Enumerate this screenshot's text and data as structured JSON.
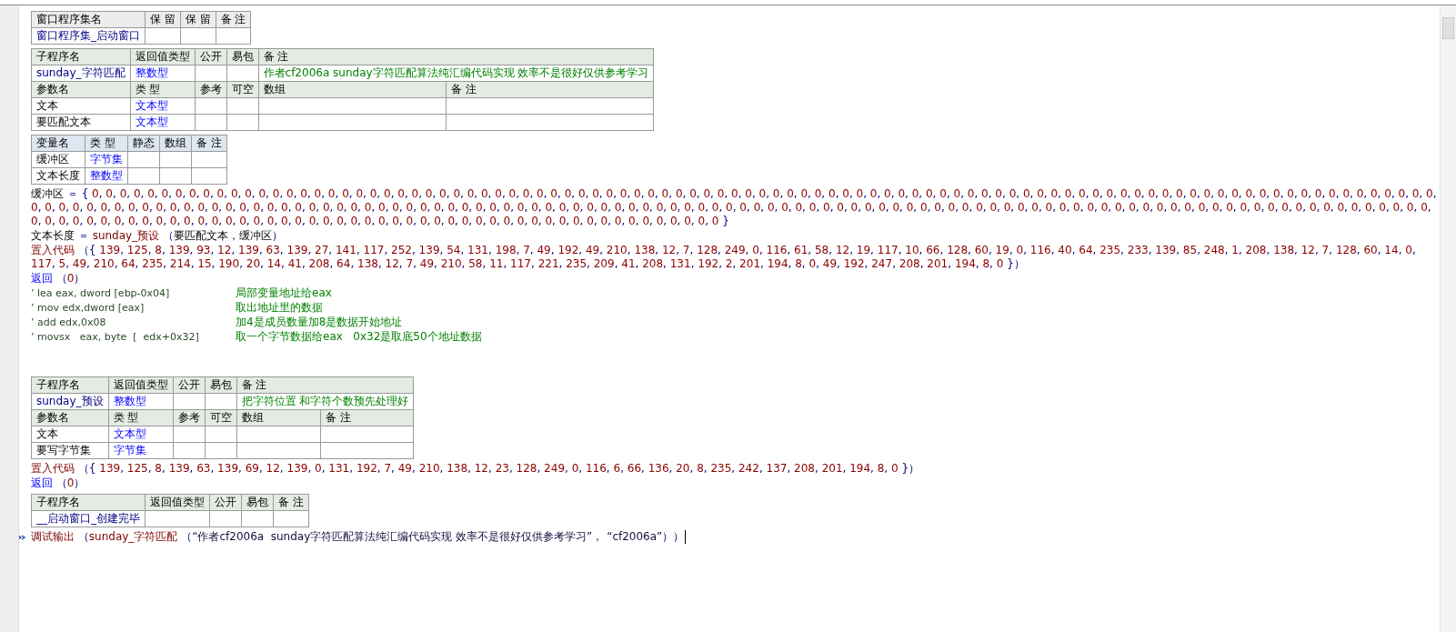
{
  "blocks": [
    {
      "kind": "table",
      "rows": [
        {
          "kind": "asmheader",
          "cells": [
            "窗口程序集名",
            "保 留",
            "保 留",
            "备 注"
          ]
        },
        {
          "kind": "asm",
          "name": "窗口程序集_启动窗口"
        }
      ]
    },
    {
      "kind": "table",
      "rows": [
        {
          "kind": "subheader",
          "cells": [
            "子程序名",
            "返回值类型",
            "公开",
            "易包",
            "备 注"
          ]
        },
        {
          "kind": "sub",
          "name": "sunday_字符匹配",
          "type": "整数型",
          "comment": "作者cf2006a  sunday字符匹配算法纯汇编代码实现 效率不是很好仅供参考学习"
        },
        {
          "kind": "paramheader",
          "cells": [
            "参数名",
            "类 型",
            "参考",
            "可空",
            "数组",
            "备 注"
          ]
        },
        {
          "kind": "param",
          "name": "文本",
          "type": "文本型"
        },
        {
          "kind": "param",
          "name": "要匹配文本",
          "type": "文本型"
        }
      ]
    },
    {
      "kind": "table",
      "rows": [
        {
          "kind": "varheader",
          "cells": [
            "变量名",
            "类 型",
            "静态",
            "数组",
            "备 注"
          ]
        },
        {
          "kind": "var",
          "name": "缓冲区",
          "type": "字节集"
        },
        {
          "kind": "var",
          "name": "文本长度",
          "type": "整数型"
        }
      ]
    },
    {
      "kind": "code",
      "segments": [
        {
          "kind": "name",
          "text": "缓冲区"
        },
        {
          "kind": "op",
          "text": " ＝ { "
        },
        {
          "kind": "numbers",
          "text": "0, 0, 0, 0, 0, 0, 0, 0, 0, 0, 0, 0, 0, 0, 0, 0, 0, 0, 0, 0, 0, 0, 0, 0, 0, 0, 0, 0, 0, 0, 0, 0, 0, 0, 0, 0, 0, 0, 0, 0, 0, 0, 0, 0, 0, 0, 0, 0, 0, 0, 0, 0, 0, 0, 0, 0, 0, 0, 0, 0, 0, 0, 0, 0, 0, 0, 0, 0, 0, 0, 0, 0, 0, 0, 0, 0, 0, 0, 0, 0, 0, 0, 0, 0, 0, 0, 0, 0, 0, 0, 0, 0, 0, 0, 0, 0, 0, 0, 0, 0, 0, 0, 0, 0, 0, 0, 0, 0, 0, 0, 0, 0, 0, 0, 0, 0, 0, 0, 0, 0, 0, 0, 0, 0, 0, 0, 0, 0, 0, 0, 0, 0, 0, 0, 0, 0, 0, 0, 0, 0, 0, 0, 0, 0, 0, 0, 0, 0, 0, 0, 0, 0, 0, 0, 0, 0, 0, 0, 0, 0, 0, 0, 0, 0, 0, 0, 0, 0, 0, 0, 0, 0, 0, 0, 0, 0, 0, 0, 0, 0, 0, 0, 0, 0, 0, 0, 0, 0, 0, 0, 0, 0, 0, 0, 0, 0, 0, 0, 0, 0, 0, 0, 0, 0, 0, 0, 0, 0, 0, 0, 0, 0, 0, 0, 0, 0, 0, 0, 0, 0, 0, 0, 0, 0, 0, 0, 0, 0, 0, 0, 0, 0, 0, 0, 0, 0, 0, 0, 0, 0, 0, 0, 0, 0, 0, 0, 0, 0"
        },
        {
          "kind": "op",
          "text": " }"
        }
      ]
    },
    {
      "kind": "code",
      "segments": [
        {
          "kind": "name",
          "text": "文本长度"
        },
        {
          "kind": "op",
          "text": " ＝ "
        },
        {
          "kind": "func",
          "text": "sunday_预设"
        },
        {
          "kind": "paren",
          "text": " （"
        },
        {
          "kind": "name",
          "text": "要匹配文本"
        },
        {
          "kind": "paren",
          "text": "，"
        },
        {
          "kind": "name",
          "text": "缓冲区"
        },
        {
          "kind": "paren",
          "text": "）"
        }
      ]
    },
    {
      "kind": "code",
      "segments": [
        {
          "kind": "func",
          "text": "置入代码"
        },
        {
          "kind": "paren",
          "text": " （{ "
        },
        {
          "kind": "numbers",
          "text": "139, 125, 8, 139, 93, 12, 139, 63, 139, 27, 141, 117, 252, 139, 54, 131, 198, 7, 49, 192, 49, 210, 138, 12, 7, 128, 249, 0, 116, 61, 58, 12, 19, 117, 10, 66, 128, 60, 19, 0, 116, 40, 64, 235, 233, 139, 85, 248, 1, 208, 138, 12, 7, 128, 60, 14, 0, 117, 5, 49, 210, 64, 235, 214, 15, 190, 20, 14, 41, 208, 64, 138, 12, 7, 49, 210, 58, 11, 117, 221, 235, 209, 41, 208, 131, 192, 2, 201, 194, 8, 0, 49, 192, 247, 208, 201, 194, 8, 0"
        },
        {
          "kind": "paren",
          "text": " }）"
        }
      ]
    },
    {
      "kind": "code",
      "segments": [
        {
          "kind": "keyword",
          "text": "返回"
        },
        {
          "kind": "paren",
          "text": " （"
        },
        {
          "kind": "number",
          "text": "0"
        },
        {
          "kind": "paren",
          "text": "）"
        }
      ]
    },
    {
      "kind": "comment",
      "code": "’ lea eax, dword [ebp-0x04]",
      "note": "局部变量地址给eax"
    },
    {
      "kind": "comment",
      "code": "’ mov edx,dword [eax]",
      "note": "取出地址里的数据"
    },
    {
      "kind": "comment",
      "code": "’ add edx,0x08",
      "note": "加4是成员数量加8是数据开始地址"
    },
    {
      "kind": "comment",
      "code": "’ movsx   eax, byte  [  edx+0x32]",
      "note": "取一个字节数据给eax   0x32是取底50个地址数据"
    },
    {
      "kind": "blank"
    },
    {
      "kind": "blank"
    },
    {
      "kind": "table",
      "rows": [
        {
          "kind": "subheader",
          "cells": [
            "子程序名",
            "返回值类型",
            "公开",
            "易包",
            "备 注"
          ]
        },
        {
          "kind": "sub",
          "name": "sunday_预设",
          "type": "整数型",
          "comment": "把字符位置 和字符个数预先处理好"
        },
        {
          "kind": "paramheader",
          "cells": [
            "参数名",
            "类 型",
            "参考",
            "可空",
            "数组",
            "备 注"
          ]
        },
        {
          "kind": "param",
          "name": "文本",
          "type": "文本型"
        },
        {
          "kind": "param",
          "name": "要写字节集",
          "type": "字节集"
        }
      ]
    },
    {
      "kind": "code",
      "segments": [
        {
          "kind": "func",
          "text": "置入代码"
        },
        {
          "kind": "paren",
          "text": " （{ "
        },
        {
          "kind": "numbers",
          "text": "139, 125, 8, 139, 63, 139, 69, 12, 139, 0, 131, 192, 7, 49, 210, 138, 12, 23, 128, 249, 0, 116, 6, 66, 136, 20, 8, 235, 242, 137, 208, 201, 194, 8, 0"
        },
        {
          "kind": "paren",
          "text": " }）"
        }
      ]
    },
    {
      "kind": "code",
      "segments": [
        {
          "kind": "keyword",
          "text": "返回"
        },
        {
          "kind": "paren",
          "text": " （"
        },
        {
          "kind": "number",
          "text": "0"
        },
        {
          "kind": "paren",
          "text": "）"
        }
      ]
    },
    {
      "kind": "table",
      "rows": [
        {
          "kind": "subheader",
          "cells": [
            "子程序名",
            "返回值类型",
            "公开",
            "易包",
            "备 注"
          ]
        },
        {
          "kind": "sub",
          "name": "__启动窗口_创建完毕"
        }
      ]
    },
    {
      "kind": "current",
      "segments": [
        {
          "kind": "func",
          "text": "调试输出"
        },
        {
          "kind": "paren",
          "text": " （"
        },
        {
          "kind": "func",
          "text": "sunday_字符匹配"
        },
        {
          "kind": "paren",
          "text": " （"
        },
        {
          "kind": "string",
          "text": "“作者cf2006a  sunday字符匹配算法纯汇编代码实现 效率不是很好仅供参考学习”"
        },
        {
          "kind": "paren",
          "text": "， "
        },
        {
          "kind": "string",
          "text": "“cf2006a”"
        },
        {
          "kind": "paren",
          "text": "））"
        }
      ]
    }
  ]
}
